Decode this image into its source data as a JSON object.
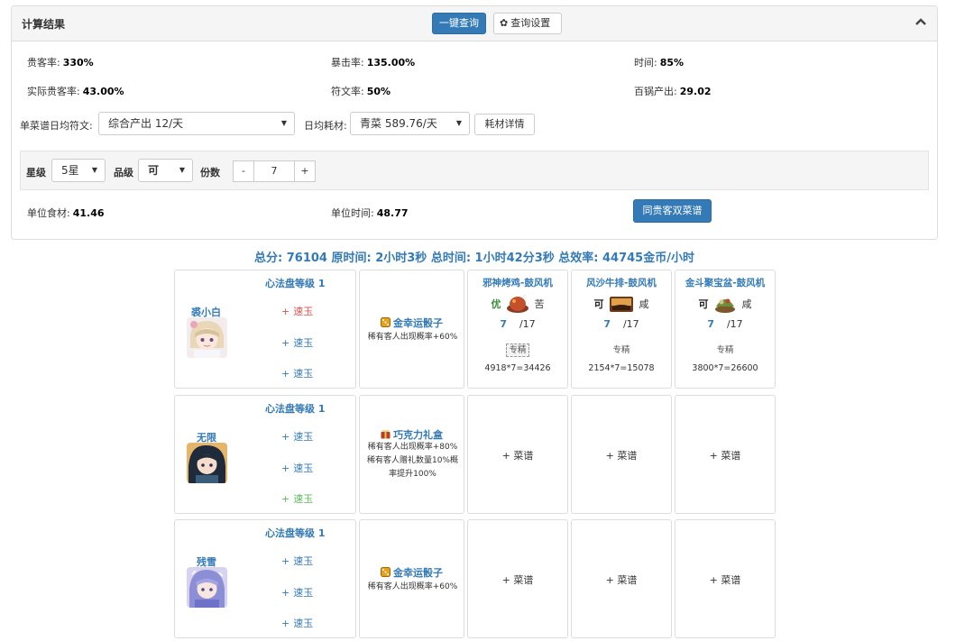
{
  "panel": {
    "title": "计算结果",
    "query_button": "一键查询",
    "settings_button": "查询设置",
    "collapse_icon": "chevron-up-icon"
  },
  "stats": [
    {
      "label": "贵客率:",
      "value": "330%"
    },
    {
      "label": "暴击率:",
      "value": "135.00%"
    },
    {
      "label": "时间:",
      "value": "85%"
    },
    {
      "label": "实际贵客率:",
      "value": "43.00%"
    },
    {
      "label": "符文率:",
      "value": "50%"
    },
    {
      "label": "百锅产出:",
      "value": "29.02"
    }
  ],
  "rune_row": {
    "rune_label": "单菜谱日均符文:",
    "rune_select": "综合产出 12/天",
    "material_label": "日均耗材:",
    "material_select": "青菜 589.76/天",
    "material_detail_button": "耗材详情"
  },
  "filter": {
    "star_label": "星级",
    "star_value": "5星",
    "grade_label": "品级",
    "grade_value": "可",
    "portion_label": "份数",
    "minus": "-",
    "portion_value": "7",
    "plus": "+"
  },
  "unit": {
    "food_label": "单位食材:",
    "food_value": "41.46",
    "time_label": "单位时间:",
    "time_value": "48.77",
    "dual_button": "同贵客双菜谱"
  },
  "summary": "总分: 76104 原时间: 2小时3秒 总时间: 1小时42分3秒 总效率: 44745金币/小时",
  "rows": [
    {
      "level": "心法盘等级 1",
      "chef": "裘小白",
      "gems": [
        {
          "sign": "+",
          "name": "速玉",
          "color": "red"
        },
        {
          "sign": "+",
          "name": "速玉",
          "color": "blue"
        },
        {
          "sign": "+",
          "name": "速玉",
          "color": "blue"
        }
      ],
      "equip": {
        "icon": "golden-dice-icon",
        "name": "金幸运骰子",
        "desc": "稀有客人出现概率+60%"
      },
      "dishes": [
        {
          "title": "邪神烤鸡-鼓风机",
          "grade": "优",
          "taste": "苦",
          "qty": "7",
          "max": "/17",
          "skill": "专精",
          "calc": "4918*7=34426"
        },
        {
          "title": "风沙牛排-鼓风机",
          "grade": "可",
          "taste": "咸",
          "qty": "7",
          "max": "/17",
          "skill": "专精",
          "calc": "2154*7=15078"
        },
        {
          "title": "金斗聚宝盆-鼓风机",
          "grade": "可",
          "taste": "咸",
          "qty": "7",
          "max": "/17",
          "skill": "专精",
          "calc": "3800*7=26600"
        }
      ]
    },
    {
      "level": "心法盘等级 1",
      "chef": "无限",
      "gems": [
        {
          "sign": "+",
          "name": "速玉",
          "color": "blue"
        },
        {
          "sign": "+",
          "name": "速玉",
          "color": "blue"
        },
        {
          "sign": "+",
          "name": "速玉",
          "color": "green"
        }
      ],
      "equip": {
        "icon": "chocolate-gift-box-icon",
        "name": "巧克力礼盒",
        "desc": "稀有客人出现概率+80% 稀有客人赠礼数量10%概率提升100%"
      },
      "add_dish": "+ 菜谱"
    },
    {
      "level": "心法盘等级 1",
      "chef": "残雪",
      "gems": [
        {
          "sign": "+",
          "name": "速玉",
          "color": "blue"
        },
        {
          "sign": "+",
          "name": "速玉",
          "color": "blue"
        },
        {
          "sign": "+",
          "name": "速玉",
          "color": "blue"
        }
      ],
      "equip": {
        "icon": "golden-dice-icon",
        "name": "金幸运骰子",
        "desc": "稀有客人出现概率+60%"
      },
      "add_dish": "+ 菜谱"
    }
  ]
}
